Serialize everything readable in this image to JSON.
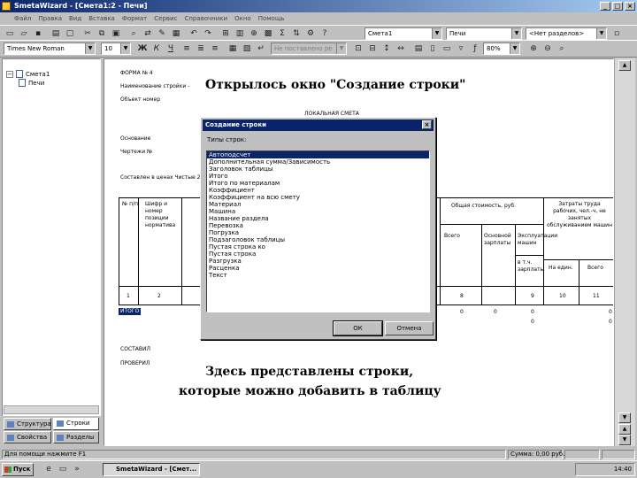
{
  "window": {
    "title": "SmetaWizard - [Смета1:2 - Печи]"
  },
  "menu": [
    "Файл",
    "Правка",
    "Вид",
    "Вставка",
    "Формат",
    "Сервис",
    "Справочники",
    "Окно",
    "Помощь"
  ],
  "toolbar1": {
    "combo_smeta": "Смета1",
    "combo_section": "Печи",
    "combo_divisions": "<Нет разделов>"
  },
  "toolbar2": {
    "font": "Times New Roman",
    "size": "10",
    "bold": "Ж",
    "italic": "К",
    "underline": "Ч",
    "style_combo": "Не поставлено ре",
    "zoom": "80%"
  },
  "tree": {
    "root": "Смета1",
    "child": "Печи"
  },
  "tabs": {
    "structure": "Структура",
    "rows": "Строки",
    "properties": "Свойства",
    "sections": "Разделы"
  },
  "document": {
    "form": "ФОРМА № 4",
    "org": "Наименование стройки -",
    "object": "Объект номер",
    "local": "ЛОКАЛЬНАЯ СМЕТА",
    "basis": "Основание",
    "drawings": "Чертежи №",
    "composed": "Составлен в ценах Чистые 2",
    "col_num": "№ п/п",
    "col_code": "Шифр и номер позиции норматива",
    "col_total": "Общая стоимость, руб.",
    "col_labor": "Затраты труда рабочих, чел.-ч, не занятых обслуживанием машин",
    "col_all": "Всего",
    "col_main": "Основной зарплаты",
    "col_exp": "Эксплуатации машин",
    "col_incl": "в т.ч. зарплаты",
    "col_unit": "На един.",
    "col_sum": "Всего",
    "num1": "1",
    "num2": "2",
    "num8": "8",
    "num9": "9",
    "num10": "10",
    "num11": "11",
    "total": "ИТОГО",
    "zero": "0",
    "composer": "СОСТАВИЛ",
    "checker": "ПРОВЕРИЛ"
  },
  "callouts": {
    "top": "Открылось окно \"Создание строки\"",
    "bottom_line1": "Здесь представлены строки,",
    "bottom_line2": "которые можно добавить в таблицу"
  },
  "dialog": {
    "title": "Создание строки",
    "label": "Типы строк:",
    "items": [
      "Автоподсчет",
      "Дополнительная сумма/Зависимость",
      "Заголовок таблицы",
      "Итого",
      "Итого по материалам",
      "Коэффициент",
      "Коэффициент на всю смету",
      "Материал",
      "Машина",
      "Название раздела",
      "Перевозка",
      "Погрузка",
      "Подзаголовок таблицы",
      "Пустая строка ко",
      "Пустая строка",
      "Разгрузка",
      "Расценка",
      "Текст"
    ],
    "selected_index": 0,
    "ok": "ОК",
    "cancel": "Отмена"
  },
  "status": {
    "left": "Для помощи нажмите F1",
    "sum": "Сумма: 0,00 руб."
  },
  "taskbar": {
    "start": "Пуск",
    "task": "SmetaWizard - [Смет...",
    "clock": "14:40"
  }
}
